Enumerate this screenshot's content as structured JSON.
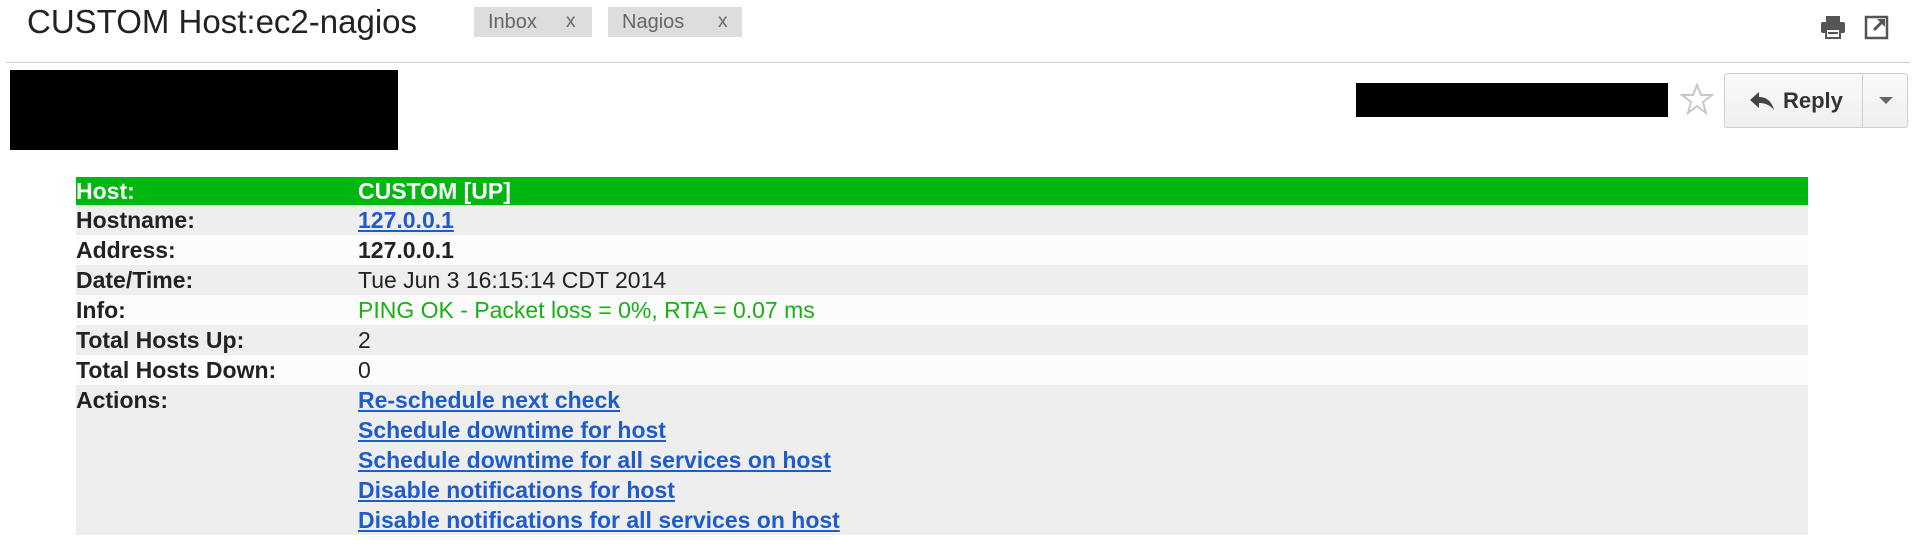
{
  "header": {
    "subject": "CUSTOM Host:ec2-nagios",
    "labels": [
      {
        "name": "Inbox",
        "close": "x"
      },
      {
        "name": "Nagios",
        "close": "x"
      }
    ],
    "icons": [
      "print-icon",
      "popout-icon"
    ]
  },
  "message_header": {
    "reply_label": "Reply",
    "star_icon": "star-icon",
    "reply_icon": "reply-arrow-icon",
    "more_icon": "chevron-down-icon"
  },
  "alert": {
    "host_label": "Host:",
    "host_value": "CUSTOM [UP]",
    "hostname_label": "Hostname:",
    "hostname_value": "127.0.0.1",
    "address_label": "Address:",
    "address_value": "127.0.0.1",
    "datetime_label": "Date/Time:",
    "datetime_value": "Tue Jun 3 16:15:14 CDT 2014",
    "info_label": "Info:",
    "info_value": "PING OK - Packet loss = 0%, RTA = 0.07 ms",
    "hosts_up_label": "Total Hosts Up:",
    "hosts_up_value": "2",
    "hosts_down_label": "Total Hosts Down:",
    "hosts_down_value": "0",
    "actions_label": "Actions:",
    "actions": [
      "Re-schedule next check",
      "Schedule downtime for host",
      "Schedule downtime for all services on host",
      "Disable notifications for host",
      "Disable notifications for all services on host"
    ]
  },
  "colors": {
    "up_green": "#00b711",
    "ok_text": "#17b114",
    "link": "#1e5ccc",
    "row_alt": "#eeeeee"
  }
}
